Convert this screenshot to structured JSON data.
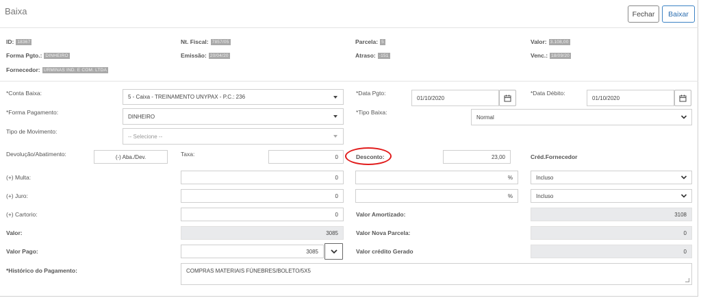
{
  "header": {
    "title": "Baixa",
    "close_label": "Fechar",
    "submit_label": "Baixar"
  },
  "info": {
    "id_label": "ID:",
    "id_value": "18367",
    "nf_label": "Nt. Fiscal:",
    "nf_value": "7857/05",
    "parcela_label": "Parcela:",
    "parcela_value": "5",
    "valor_label": "Valor:",
    "valor_value": "3.108,00",
    "forma_label": "Forma Pgto.:",
    "forma_value": "DINHEIRO",
    "emissao_label": "Emissão:",
    "emissao_value": "20/04/20",
    "atraso_label": "Atraso:",
    "atraso_value": "-151",
    "venc_label": "Venc.:",
    "venc_value": "18/09/20",
    "fornecedor_label": "Fornecedor:",
    "fornecedor_value": "URMINAS IND. E COM. LTDA"
  },
  "form": {
    "conta_baixa_label": "*Conta Baixa:",
    "conta_baixa_value": "5 - Caixa - TREINAMENTO UNYPAX - P.C.: 236",
    "data_pgto_label": "*Data Pgto:",
    "data_pgto_value": "01/10/2020",
    "data_debito_label": "*Data Débito:",
    "data_debito_value": "01/10/2020",
    "forma_pagamento_label": "*Forma Pagamento:",
    "forma_pagamento_value": "DINHEIRO",
    "tipo_baixa_label": "*Tipo Baixa:",
    "tipo_baixa_value": "Normal",
    "tipo_mov_label": "Tipo de Movimento:",
    "tipo_mov_placeholder": "-- Selecione --",
    "devolucao_label": "Devolução/Abatimento:",
    "devolucao_button": "(-) Aba./Dev.",
    "taxa_label": "Taxa:",
    "taxa_value": "0",
    "desconto_label": "Desconto:",
    "desconto_value": "23,00",
    "cred_fornecedor_label": "Créd.Fornecedor",
    "multa_label": "(+) Multa:",
    "multa_value": "0",
    "multa_pct_suffix": "%",
    "multa_option": "Incluso",
    "juro_label": "(+) Juro:",
    "juro_value": "0",
    "juro_pct_suffix": "%",
    "juro_option": "Incluso",
    "cartorio_label": "(+) Cartorio:",
    "cartorio_value": "0",
    "valor_amortizado_label": "Valor Amortizado:",
    "valor_amortizado_value": "3108",
    "valor_label": "Valor:",
    "valor_value": "3085",
    "valor_nova_parcela_label": "Valor Nova Parcela:",
    "valor_nova_parcela_value": "0",
    "valor_pago_label": "Valor Pago:",
    "valor_pago_value": "3085",
    "valor_credito_label": "Valor crédito Gerado",
    "valor_credito_value": "0",
    "historico_label": "*Histórico do Pagamento:",
    "historico_value": "COMPRAS MATERIAIS FÚNEBRES/BOLETO/5X5"
  },
  "annotation": {
    "color": "#e11b1b"
  }
}
